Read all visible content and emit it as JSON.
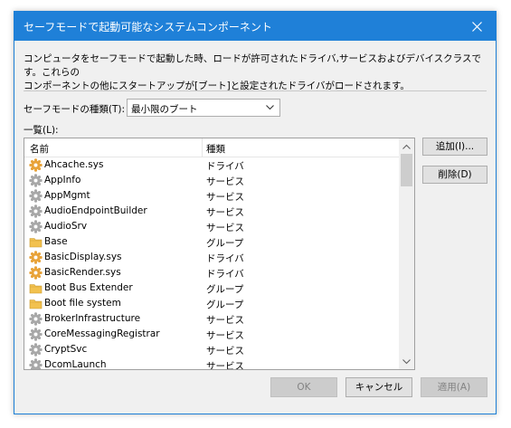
{
  "window": {
    "title": "セーフモードで起動可能なシステムコンポーネント",
    "description_line1": "コンピュータをセーフモードで起動した時、ロードが許可されたドライバ,サービスおよびデバイスクラスです。これらの",
    "description_line2": "コンポーネントの他にスタートアップが[ブート]と設定されたドライバがロードされます。"
  },
  "mode": {
    "label": "セーフモードの種類(T):",
    "selected": "最小限のブート"
  },
  "list": {
    "label": "一覧(L):",
    "col_name": "名前",
    "col_type": "種類",
    "rows": [
      {
        "name": "Ahcache.sys",
        "type": "ドライバ",
        "icon": "gear-icon"
      },
      {
        "name": "AppInfo",
        "type": "サービス",
        "icon": "service-gear-icon"
      },
      {
        "name": "AppMgmt",
        "type": "サービス",
        "icon": "service-gear-icon"
      },
      {
        "name": "AudioEndpointBuilder",
        "type": "サービス",
        "icon": "service-gear-icon"
      },
      {
        "name": "AudioSrv",
        "type": "サービス",
        "icon": "service-gear-icon"
      },
      {
        "name": "Base",
        "type": "グループ",
        "icon": "folder-icon"
      },
      {
        "name": "BasicDisplay.sys",
        "type": "ドライバ",
        "icon": "gear-icon"
      },
      {
        "name": "BasicRender.sys",
        "type": "ドライバ",
        "icon": "gear-icon"
      },
      {
        "name": "Boot Bus Extender",
        "type": "グループ",
        "icon": "folder-icon"
      },
      {
        "name": "Boot file system",
        "type": "グループ",
        "icon": "folder-icon"
      },
      {
        "name": "BrokerInfrastructure",
        "type": "サービス",
        "icon": "service-gear-icon"
      },
      {
        "name": "CoreMessagingRegistrar",
        "type": "サービス",
        "icon": "service-gear-icon"
      },
      {
        "name": "CryptSvc",
        "type": "サービス",
        "icon": "service-gear-icon"
      },
      {
        "name": "DcomLaunch",
        "type": "サービス",
        "icon": "service-gear-icon"
      }
    ]
  },
  "buttons": {
    "add": "追加(I)...",
    "delete": "削除(D)",
    "ok": "OK",
    "cancel": "キャンセル",
    "apply": "適用(A)"
  },
  "colors": {
    "titlebar": "#1f80d8",
    "driver_gear": "#e8a33a",
    "service_gear": "#a8a8a8",
    "folder": "#f2c14e"
  }
}
